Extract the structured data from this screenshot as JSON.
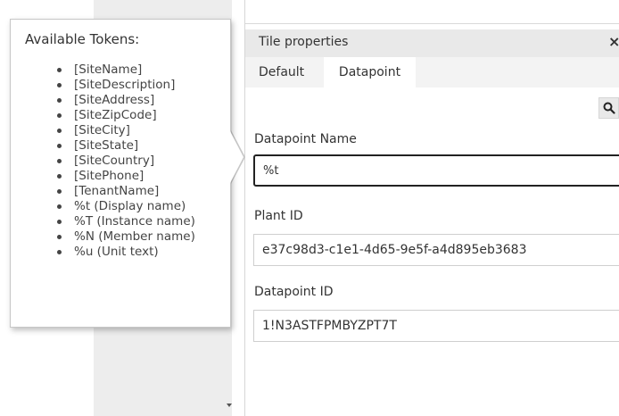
{
  "tokens_panel": {
    "title": "Available Tokens:",
    "tokens": [
      "[SiteName]",
      "[SiteDescription]",
      "[SiteAddress]",
      "[SiteZipCode]",
      "[SiteCity]",
      "[SiteState]",
      "[SiteCountry]",
      "[SitePhone]",
      "[TenantName]",
      "%t (Display name)",
      "%T (Instance name)",
      "%N (Member name)",
      "%u (Unit text)"
    ]
  },
  "tile_properties": {
    "title": "Tile properties",
    "close_glyph": "×",
    "tabs": [
      {
        "label": "Default",
        "active": false
      },
      {
        "label": "Datapoint",
        "active": true
      }
    ],
    "fields": {
      "datapoint_name": {
        "label": "Datapoint Name",
        "value": "%t"
      },
      "plant_id": {
        "label": "Plant ID",
        "value": "e37c98d3-c1e1-4d65-9e5f-a4d895eb3683"
      },
      "datapoint_id": {
        "label": "Datapoint ID",
        "value": "1!N3ASTFPMBYZPT7T"
      }
    }
  },
  "icons": {
    "search": "search-icon",
    "close": "close-icon",
    "scroll_down": "chevron-down-icon"
  }
}
